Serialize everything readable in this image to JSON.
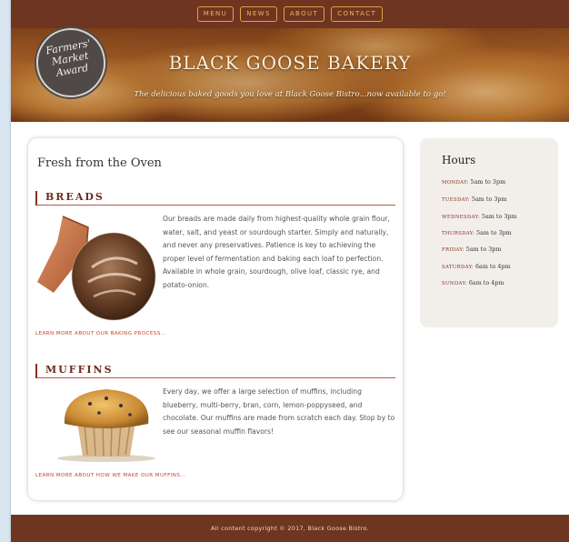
{
  "nav": {
    "items": [
      "MENU",
      "NEWS",
      "ABOUT",
      "CONTACT"
    ]
  },
  "hero": {
    "award": [
      "Farmers'",
      "Market",
      "Award"
    ],
    "title": "BLACK GOOSE BAKERY",
    "tagline": "The delicious baked goods you love at Black Goose Bistro...now available to go!"
  },
  "main": {
    "heading": "Fresh from the Oven",
    "breads": {
      "title": "BREADS",
      "text": "Our breads are made daily from highest-quality whole grain flour, water, salt, and yeast or sourdough starter. Simply and naturally, and never any preservatives. Patience is key to achieving the proper level of fermentation and baking each loaf to perfection. Available in whole grain, sourdough, olive loaf, classic rye, and potato-onion.",
      "link": "LEARN MORE ABOUT OUR BAKING PROCESS..."
    },
    "muffins": {
      "title": "MUFFINS",
      "text": "Every day, we offer a large selection of muffins, including blueberry, multi-berry, bran, corn, lemon-poppyseed, and chocolate. Our muffins are made from scratch each day. Stop by to see our seasonal muffin flavors!",
      "link": "LEARN MORE ABOUT HOW WE MAKE OUR MUFFINS..."
    }
  },
  "hours": {
    "title": "Hours",
    "rows": [
      {
        "day": "MONDAY:",
        "time": "5am to 3pm"
      },
      {
        "day": "TUESDAY:",
        "time": "5am to 3pm"
      },
      {
        "day": "WEDNESDAY:",
        "time": "5am to 3pm"
      },
      {
        "day": "THURSDAY:",
        "time": "5am to 3pm"
      },
      {
        "day": "FRIDAY:",
        "time": "5am to 3pm"
      },
      {
        "day": "SATURDAY:",
        "time": "6am to 4pm"
      },
      {
        "day": "SUNDAY:",
        "time": "6am to 4pm"
      }
    ]
  },
  "footer": {
    "text": "All content copyright © 2017, Black Goose Bistro."
  },
  "colors": {
    "brand_brown": "#6e3520",
    "nav_accent": "#f1b25a",
    "heading_red": "#8a2f22",
    "link": "#c4452a"
  }
}
